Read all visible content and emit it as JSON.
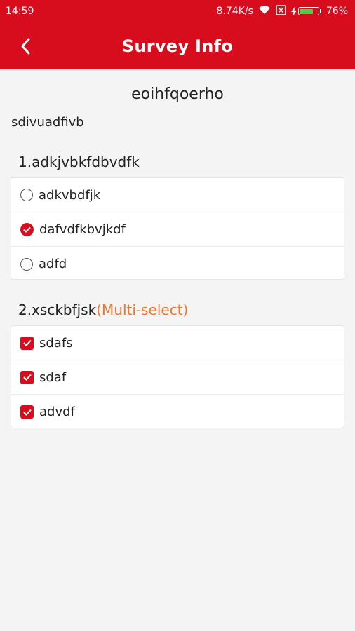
{
  "status_bar": {
    "time": "14:59",
    "network_speed": "8.74K/s",
    "battery_percent": "76%",
    "battery_level": 0.76,
    "icons": [
      "wifi-icon",
      "sim-icon",
      "charging-icon",
      "battery-icon"
    ]
  },
  "header": {
    "title": "Survey Info",
    "back_icon": "chevron-left-icon"
  },
  "survey": {
    "title": "eoihfqoerho",
    "description": "sdivuadfivb"
  },
  "questions": [
    {
      "title": "1.adkjvbkfdbvdfk",
      "type": "single",
      "options": [
        {
          "label": "adkvbdfjk",
          "selected": false
        },
        {
          "label": "dafvdfkbvjkdf",
          "selected": true
        },
        {
          "label": "adfd",
          "selected": false
        }
      ]
    },
    {
      "title": "2.xsckbfjsk",
      "type_label": "(Multi-select)",
      "type": "multi",
      "options": [
        {
          "label": "sdafs",
          "selected": true
        },
        {
          "label": "sdaf",
          "selected": true
        },
        {
          "label": "advdf",
          "selected": true
        }
      ]
    }
  ],
  "colors": {
    "brand_red": "#d70d1e",
    "accent_orange": "#f0762b",
    "background": "#f4f4f4"
  }
}
